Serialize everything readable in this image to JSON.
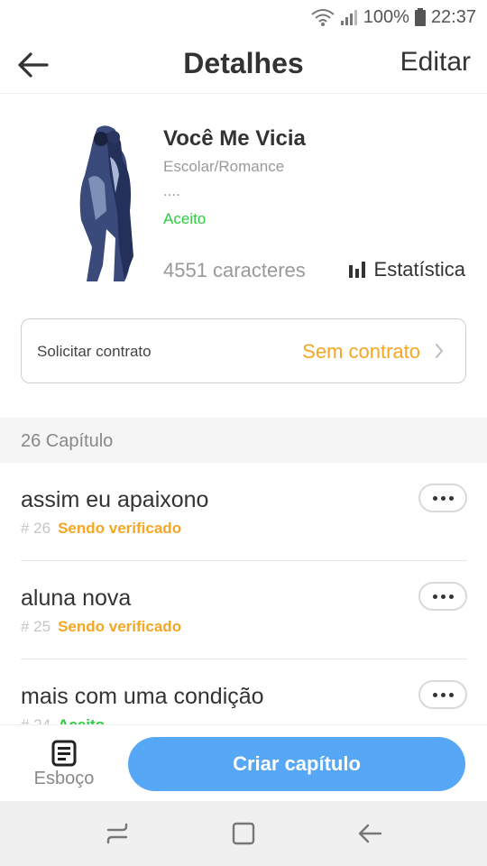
{
  "status_bar": {
    "battery": "100%",
    "time": "22:37"
  },
  "header": {
    "title": "Detalhes",
    "edit_label": "Editar"
  },
  "book": {
    "title": "Você Me Vicia",
    "genre": "Escolar/Romance",
    "description": "....",
    "status": "Aceito",
    "char_count": "4551 caracteres",
    "stats_label": "Estatística"
  },
  "contract": {
    "label": "Solicitar contrato",
    "value": "Sem contrato"
  },
  "chapters": {
    "count_label": "26 Capítulo",
    "items": [
      {
        "title": "assim eu apaixono",
        "number": "# 26",
        "status": "Sendo verificado"
      },
      {
        "title": "aluna nova",
        "number": "# 25",
        "status": "Sendo verificado"
      },
      {
        "title": "mais com uma condição",
        "number": "# 24",
        "status": "Aceito"
      }
    ]
  },
  "bottom": {
    "draft_label": "Esboço",
    "create_label": "Criar capítulo"
  },
  "colors": {
    "accent": "#56a7f5",
    "pending": "#f5a623",
    "accepted": "#2ecc40"
  },
  "icons": [
    "wifi-icon",
    "signal-icon",
    "battery-icon",
    "back-arrow-icon",
    "bar-chart-icon",
    "chevron-right-icon",
    "more-dots-icon",
    "draft-icon",
    "recent-apps-icon",
    "home-icon",
    "back-nav-icon"
  ]
}
